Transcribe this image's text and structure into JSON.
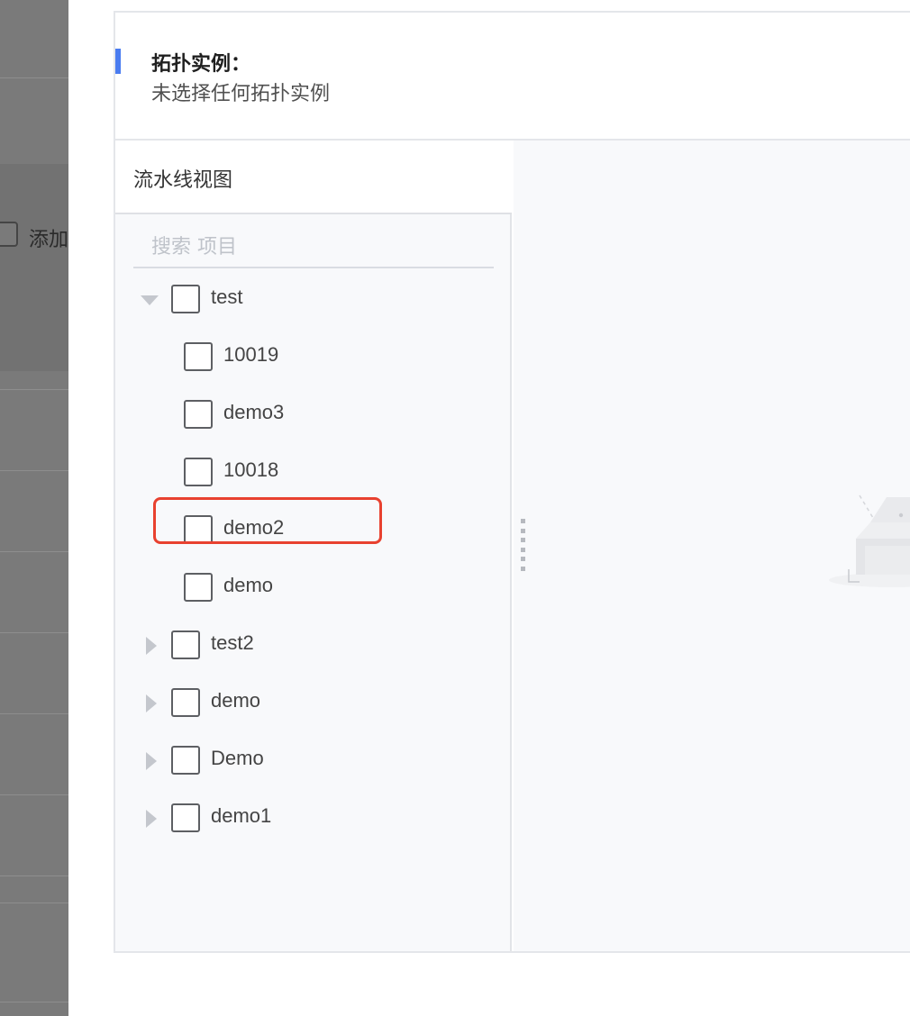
{
  "background_page": {
    "label_partial": "添加"
  },
  "header": {
    "title": "拓扑实例：",
    "subtitle": "未选择任何拓扑实例"
  },
  "left_pane": {
    "title": "流水线视图",
    "search_placeholder": "搜索 项目"
  },
  "tree": [
    {
      "label": "test",
      "expanded": true,
      "level": 0
    },
    {
      "label": "10019",
      "level": 1
    },
    {
      "label": "demo3",
      "level": 1
    },
    {
      "label": "10018",
      "level": 1
    },
    {
      "label": "demo2",
      "level": 1,
      "highlighted": true
    },
    {
      "label": "demo",
      "level": 1
    },
    {
      "label": "test2",
      "expanded": false,
      "level": 0
    },
    {
      "label": "demo",
      "expanded": false,
      "level": 0
    },
    {
      "label": "Demo",
      "expanded": false,
      "level": 0
    },
    {
      "label": "demo1",
      "expanded": false,
      "level": 0
    }
  ],
  "colors": {
    "accent": "#4a7cf0",
    "highlight": "#e8412f",
    "overlay": "#7a7a7a"
  }
}
